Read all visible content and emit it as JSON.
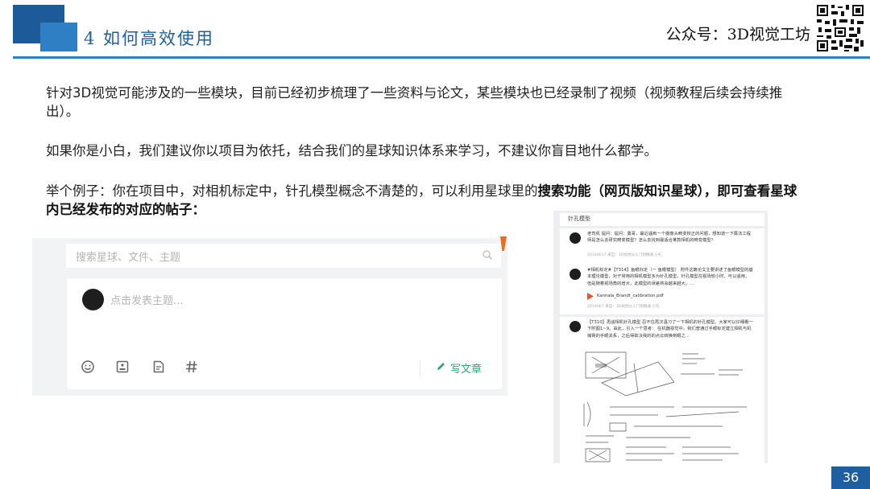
{
  "header": {
    "section_title": "4 如何高效使用",
    "brand": "公众号：3D视觉工坊"
  },
  "body": {
    "para1": "针对3D视觉可能涉及的一些模块，目前已经初步梳理了一些资料与论文，某些模块也已经录制了视频（视频教程后续会持续推出）。",
    "para2": "如果你是小白，我们建议你以项目为依托，结合我们的星球知识体系来学习，不建议你盲目地什么都学。",
    "para3_normal": "举个例子：你在项目中，对相机标定中，针孔模型概念不清楚的，可以利用星球里的",
    "para3_bold": "搜索功能（网页版知识星球），即可查看星球内已经发布的对应的帖子："
  },
  "left_screenshot": {
    "search_placeholder": "搜索星球、文件、主题",
    "post_placeholder": "点击发表主题...",
    "write_article_label": "写文章",
    "icons": [
      "emoji-icon",
      "image-icon",
      "file-icon",
      "hashtag-icon"
    ]
  },
  "right_screenshot": {
    "search_term": "针孔模型",
    "posts": [
      {
        "text": "老司机 提问：提问：勇哥，最近遇到一个摄像头畸变校正的问题，想知道一下算法工程师是怎么去研究畸变模型？怎么去找到最适合某款相机的畸变模型？",
        "meta": "2019/8/17  来自：3D视觉从入门到精通  小孔"
      },
      {
        "text": "#相机标定#【T314】鱼眼标定（一 鱼眼模型）  附件这篇论文主要讲述了鱼眼模型的基本理论模型，对于常用的相机模型多为针孔模型，针孔模型在视场较小时，可以适用，但是随着视场角的增大，此模型的误差将会越来越大。...",
        "attachment": "Kannala_Brandt_calibration.pdf",
        "meta": "2019/8/7  来自：3D视觉从入门到精通  小孔"
      },
      {
        "text": "【T310】再谈相机针孔模型  忍不住再次温习了一下相机的针孔模型。大家可以仔细看一下附图1~9。由此，引入一个思考：  在机器视觉中，我们普通过手眼标定建立相机与机械臂的手眼关系，之后得取决我的的点云转换到眼之..."
      }
    ]
  },
  "page_number": "36",
  "colors": {
    "primary_blue": "#1d5fa0",
    "light_blue": "#2f7fc4",
    "accent_green": "#2aa876",
    "accent_orange": "#f26b1d"
  }
}
